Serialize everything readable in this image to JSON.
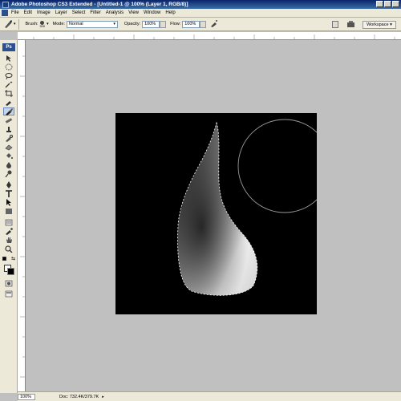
{
  "window": {
    "title": "Adobe Photoshop CS3 Extended - [Untitled-1 @ 100% (Layer 1, RGB/8)]"
  },
  "menubar": {
    "items": [
      "File",
      "Edit",
      "Image",
      "Layer",
      "Select",
      "Filter",
      "Analysis",
      "View",
      "Window",
      "Help"
    ]
  },
  "options": {
    "brush_label": "Brush:",
    "brush_size": "300",
    "mode_label": "Mode:",
    "mode_value": "Normal",
    "opacity_label": "Opacity:",
    "opacity_value": "100%",
    "flow_label": "Flow:",
    "flow_value": "100%",
    "workspace_label": "Workspace ▾"
  },
  "toolbox": {
    "badge": "Ps"
  },
  "status": {
    "zoom": "100%",
    "doc": "Doc: 732.4K/379.7K"
  },
  "colors": {
    "canvas": "#000000",
    "workspace": "#c0c0c0",
    "brush_cursor": "#9a9a9a"
  }
}
